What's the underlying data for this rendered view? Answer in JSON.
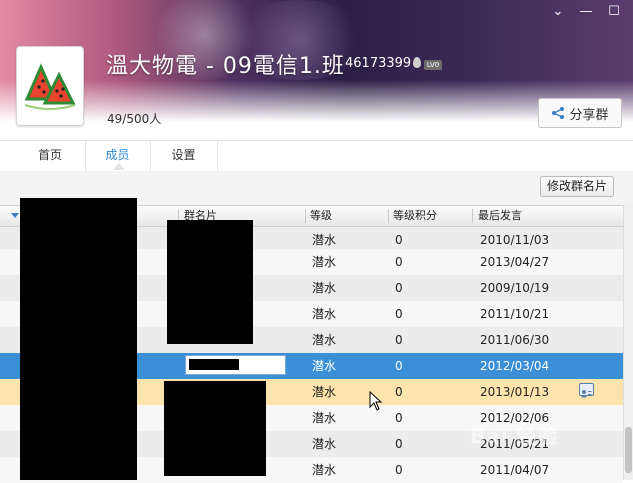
{
  "header": {
    "group_name": "溫大物電 - 09電信1.班",
    "group_number": "46173399",
    "level_badge": "LV0",
    "member_count": "49/500人",
    "share_button": "分享群",
    "window_controls": [
      "⌄",
      "—",
      "☐"
    ]
  },
  "tabs": [
    {
      "label": "首页"
    },
    {
      "label": "成员"
    },
    {
      "label": "设置"
    }
  ],
  "toolbar": {
    "edit_card_button": "修改群名片"
  },
  "table": {
    "headers": {
      "card": "群名片",
      "level": "等级",
      "points": "等级积分",
      "last_post": "最后发言"
    },
    "rows": [
      {
        "level": "潜水",
        "points": "0",
        "last_post": "2010/11/03"
      },
      {
        "level": "潜水",
        "points": "0",
        "last_post": "2013/04/27"
      },
      {
        "level": "潜水",
        "points": "0",
        "last_post": "2009/10/19"
      },
      {
        "level": "潜水",
        "points": "0",
        "last_post": "2011/10/21"
      },
      {
        "level": "潜水",
        "points": "0",
        "last_post": "2011/06/30"
      },
      {
        "level": "潜水",
        "points": "0",
        "last_post": "2012/03/04"
      },
      {
        "level": "潜水",
        "points": "0",
        "last_post": "2013/01/13"
      },
      {
        "level": "潜水",
        "points": "0",
        "last_post": "2012/02/06"
      },
      {
        "level": "潜水",
        "points": "0",
        "last_post": "2011/05/21"
      },
      {
        "level": "潜水",
        "points": "0",
        "last_post": "2011/04/07"
      }
    ]
  },
  "watermark": "Bai 经验",
  "colors": {
    "accent": "#2b89d8",
    "selected_row": "#3b8fd7",
    "hover_row": "#fde3ac"
  }
}
